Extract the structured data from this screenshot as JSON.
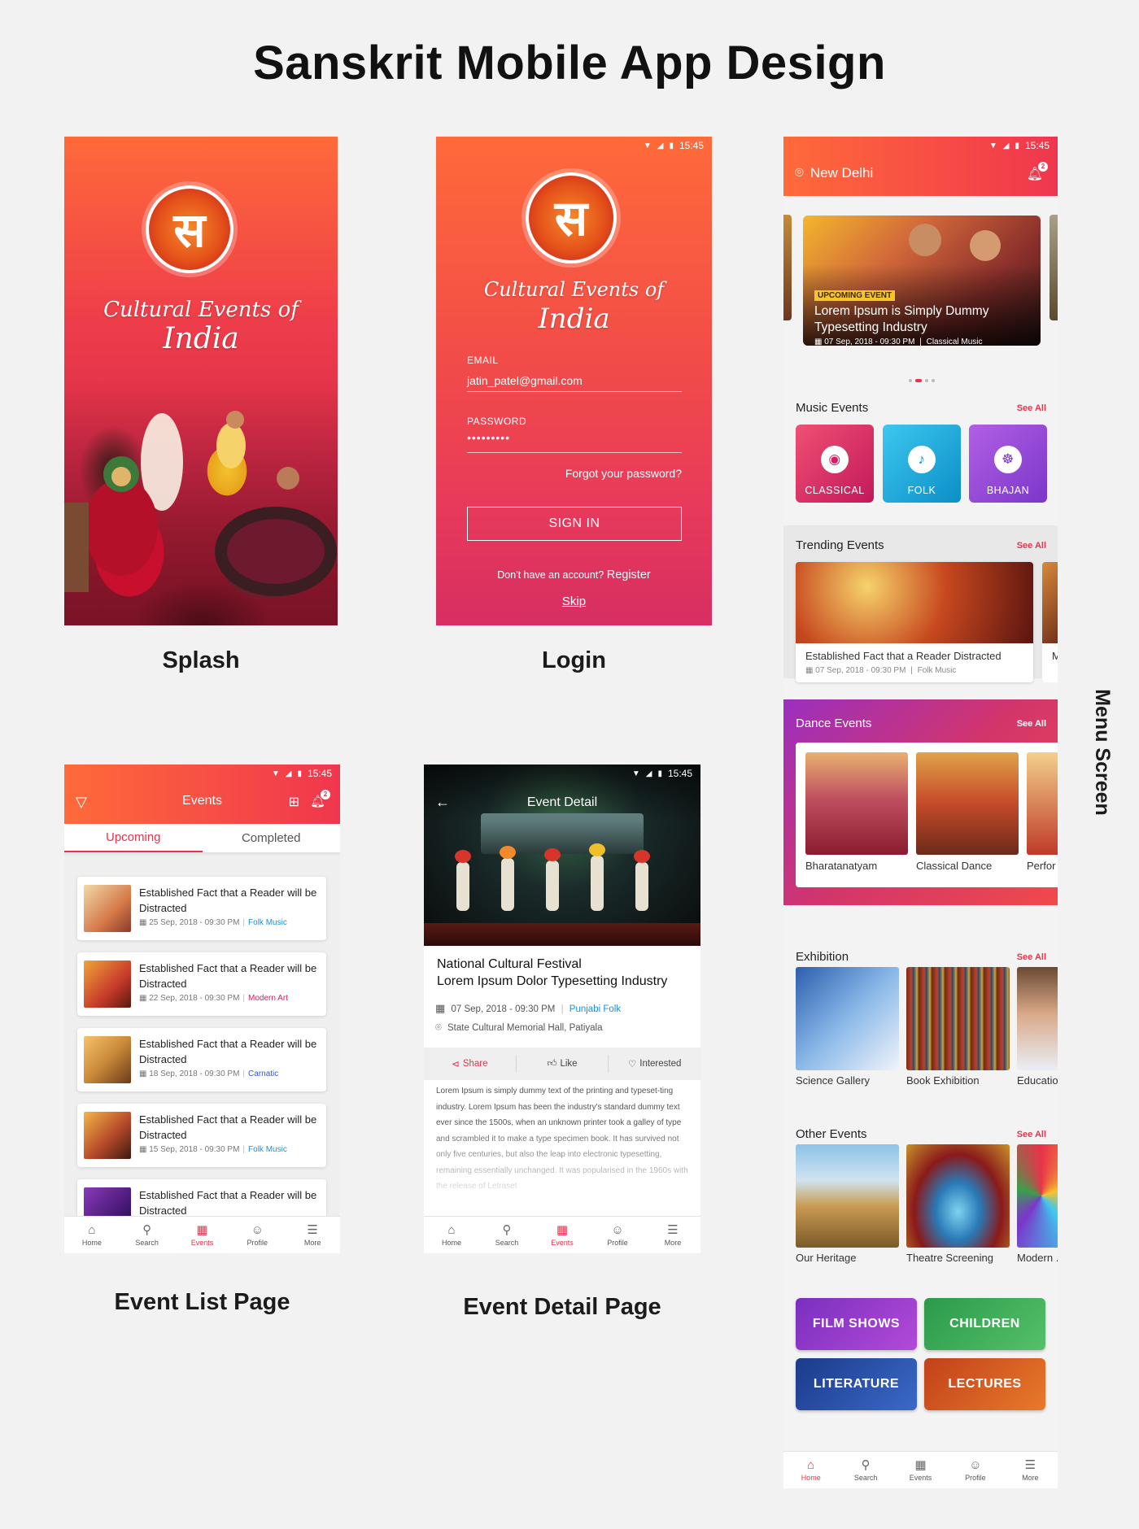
{
  "title": "Sanskrit Mobile App Design",
  "captions": {
    "splash": "Splash",
    "login": "Login",
    "menu": "Menu Screen",
    "event_list": "Event List Page",
    "event_detail": "Event Detail Page"
  },
  "status_time": "15:45",
  "brand": {
    "line1": "Cultural Events of",
    "line2": "India"
  },
  "login": {
    "email_label": "EMAIL",
    "email_value": "jatin_patel@gmail.com",
    "password_label": "PASSWORD",
    "password_mask": "•••••••••",
    "forgot": "Forgot your password?",
    "signin": "SIGN IN",
    "no_account": "Don't have an account?",
    "register": "Register",
    "skip": "Skip"
  },
  "menu": {
    "location": "New Delhi",
    "notif_count": "2",
    "hero": {
      "badge": "UPCOMING EVENT",
      "title_line1": "Lorem Ipsum is Simply Dummy",
      "title_line2": "Typesetting Industry",
      "date": "07 Sep, 2018 - 09:30 PM",
      "category": "Classical Music"
    },
    "see_all": "See All",
    "music_title": "Music Events",
    "music": [
      "CLASSICAL",
      "FOLK",
      "BHAJAN"
    ],
    "trending_title": "Trending Events",
    "trending_card": {
      "title": "Established Fact that a Reader Distracted",
      "date": "07 Sep, 2018 - 09:30 PM",
      "category": "Folk Music",
      "peek_letter": "M"
    },
    "dance_title": "Dance Events",
    "dance": [
      "Bharatanatyam",
      "Classical Dance",
      "Perfor"
    ],
    "exhibition_title": "Exhibition",
    "exhibition": [
      "Science Gallery",
      "Book Exhibition",
      "Educatio"
    ],
    "other_title": "Other Events",
    "other": [
      "Our Heritage",
      "Theatre Screening",
      "Modern ."
    ],
    "categories": [
      "FILM SHOWS",
      "CHILDREN",
      "LITERATURE",
      "LECTURES"
    ]
  },
  "nav": [
    "Home",
    "Search",
    "Events",
    "Profile",
    "More"
  ],
  "event_list": {
    "header": "Events",
    "notif_count": "2",
    "tabs": [
      "Upcoming",
      "Completed"
    ],
    "items": [
      {
        "title": "Established Fact that a Reader will be Distracted",
        "date": "25 Sep, 2018 - 09:30 PM",
        "category": "Folk Music",
        "cat_color": "#1a8fd8"
      },
      {
        "title": "Established Fact that a Reader will be Distracted",
        "date": "22 Sep, 2018 - 09:30 PM",
        "category": "Modern Art",
        "cat_color": "#d81b60"
      },
      {
        "title": "Established Fact that a Reader will be Distracted",
        "date": "18 Sep, 2018 - 09:30 PM",
        "category": "Carnatic",
        "cat_color": "#3557c9"
      },
      {
        "title": "Established Fact that a Reader will be Distracted",
        "date": "15 Sep, 2018 - 09:30 PM",
        "category": "Folk Music",
        "cat_color": "#1a8fd8"
      },
      {
        "title": "Established Fact that a Reader will be Distracted",
        "date": "",
        "category": "",
        "cat_color": "#1a8fd8"
      }
    ]
  },
  "event_detail": {
    "header": "Event Detail",
    "title_line1": "National Cultural Festival",
    "title_line2": "Lorem Ipsum Dolor Typesetting Industry",
    "date": "07 Sep, 2018 - 09:30 PM",
    "category": "Punjabi Folk",
    "venue": "State Cultural Memorial Hall, Patiyala",
    "share": "Share",
    "like": "Like",
    "interested": "Interested",
    "body": "Lorem Ipsum is simply dummy text of the printing and typeset-ting industry. Lorem Ipsum has been the industry's standard dummy text ever since the 1500s, when an unknown printer took a galley of type and scrambled it to make a type specimen book. It has survived not only five centuries, but also the leap into electronic typesetting, remaining essentially unchanged. It was popularised in the 1960s with the release of Letraset"
  },
  "colors": {
    "accent": "#e8334a",
    "orange": "#ff6a3a",
    "background": "#f2f2f2"
  }
}
